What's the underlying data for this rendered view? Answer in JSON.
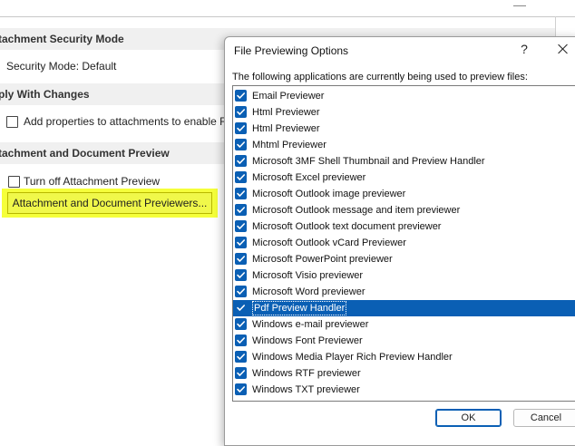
{
  "background": {
    "sections": [
      {
        "header": "tachment Security Mode",
        "items": [
          {
            "type": "text",
            "label": "Security Mode: Default"
          }
        ]
      },
      {
        "header": "ply With Changes",
        "items": [
          {
            "type": "checkbox",
            "label": "Add properties to attachments to enable R",
            "checked": false
          }
        ]
      },
      {
        "header": "tachment and Document Preview",
        "items": [
          {
            "type": "checkbox",
            "label": "Turn off Attachment Preview",
            "checked": false
          }
        ]
      }
    ],
    "previewers_button": "Attachment and Document Previewers..."
  },
  "dialog": {
    "title": "File Previewing Options",
    "help": "?",
    "description": "The following applications are currently being used to preview files:",
    "items": [
      {
        "label": "Email Previewer",
        "checked": true
      },
      {
        "label": "Html Previewer",
        "checked": true
      },
      {
        "label": "Html Previewer",
        "checked": true
      },
      {
        "label": "Mhtml Previewer",
        "checked": true
      },
      {
        "label": "Microsoft 3MF Shell Thumbnail and Preview Handler",
        "checked": true
      },
      {
        "label": "Microsoft Excel previewer",
        "checked": true
      },
      {
        "label": "Microsoft Outlook image previewer",
        "checked": true
      },
      {
        "label": "Microsoft Outlook message and item previewer",
        "checked": true
      },
      {
        "label": "Microsoft Outlook text document previewer",
        "checked": true
      },
      {
        "label": "Microsoft Outlook vCard Previewer",
        "checked": true
      },
      {
        "label": "Microsoft PowerPoint previewer",
        "checked": true
      },
      {
        "label": "Microsoft Visio previewer",
        "checked": true
      },
      {
        "label": "Microsoft Word previewer",
        "checked": true
      },
      {
        "label": "Pdf Preview Handler",
        "checked": true,
        "selected": true
      },
      {
        "label": "Windows e-mail previewer",
        "checked": true
      },
      {
        "label": "Windows Font Previewer",
        "checked": true
      },
      {
        "label": "Windows Media Player Rich Preview Handler",
        "checked": true
      },
      {
        "label": "Windows RTF previewer",
        "checked": true
      },
      {
        "label": "Windows TXT previewer",
        "checked": true
      }
    ],
    "ok_label": "OK",
    "cancel_label": "Cancel"
  },
  "colors": {
    "accent": "#0a5fb4",
    "highlight": "#f5ff3a",
    "section_bg": "#f0f0f0"
  }
}
